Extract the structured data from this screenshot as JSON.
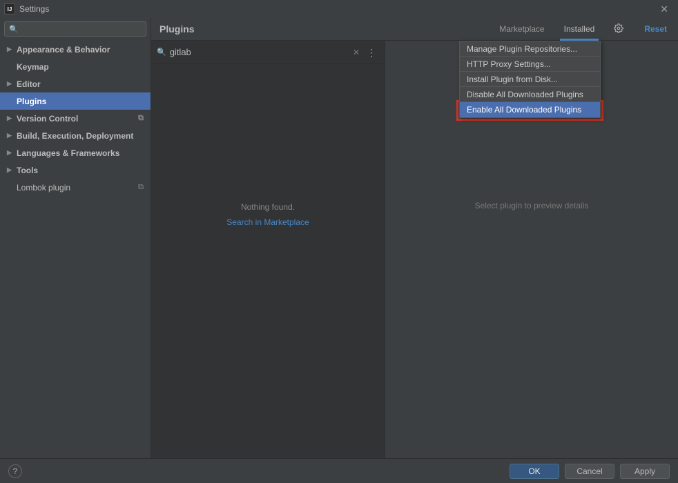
{
  "title": "Settings",
  "sidebar": {
    "search_placeholder": "",
    "items": [
      {
        "label": "Appearance & Behavior",
        "arrow": true,
        "bold": true
      },
      {
        "label": "Keymap",
        "arrow": false,
        "bold": true
      },
      {
        "label": "Editor",
        "arrow": true,
        "bold": true
      },
      {
        "label": "Plugins",
        "arrow": false,
        "bold": true,
        "selected": true
      },
      {
        "label": "Version Control",
        "arrow": true,
        "bold": true,
        "badge": "⧉"
      },
      {
        "label": "Build, Execution, Deployment",
        "arrow": true,
        "bold": true
      },
      {
        "label": "Languages & Frameworks",
        "arrow": true,
        "bold": true
      },
      {
        "label": "Tools",
        "arrow": true,
        "bold": true
      },
      {
        "label": "Lombok plugin",
        "arrow": false,
        "bold": false,
        "badge": "⧉"
      }
    ]
  },
  "content": {
    "title": "Plugins",
    "tabs": {
      "marketplace": "Marketplace",
      "installed": "Installed"
    },
    "reset": "Reset",
    "search_value": "gitlab",
    "nothing": "Nothing found.",
    "search_marketplace": "Search in Marketplace",
    "preview_hint": "Select plugin to preview details"
  },
  "dropdown": {
    "items": [
      "Manage Plugin Repositories...",
      "HTTP Proxy Settings...",
      "Install Plugin from Disk...",
      "Disable All Downloaded Plugins",
      "Enable All Downloaded Plugins"
    ],
    "highlight_index": 4
  },
  "footer": {
    "ok": "OK",
    "cancel": "Cancel",
    "apply": "Apply"
  }
}
